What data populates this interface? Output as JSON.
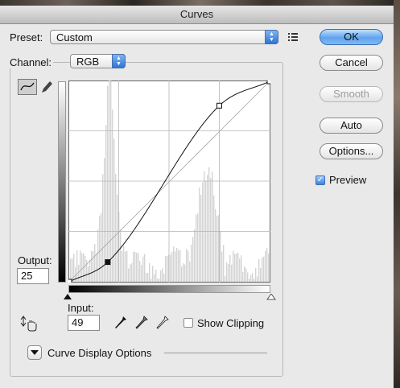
{
  "window": {
    "title": "Curves"
  },
  "preset": {
    "label": "Preset:",
    "value": "Custom"
  },
  "channel": {
    "label": "Channel:",
    "value": "RGB"
  },
  "buttons": {
    "ok": "OK",
    "cancel": "Cancel",
    "smooth": "Smooth",
    "auto": "Auto",
    "options": "Options..."
  },
  "preview": {
    "label": "Preview",
    "checked": true
  },
  "output": {
    "label": "Output:",
    "value": "25"
  },
  "input": {
    "label": "Input:",
    "value": "49"
  },
  "show_clipping": {
    "label": "Show Clipping",
    "checked": false
  },
  "curve_display_options": {
    "label": "Curve Display Options"
  },
  "curve": {
    "control_points": [
      [
        0,
        0
      ],
      [
        49,
        25
      ],
      [
        191,
        224
      ],
      [
        255,
        255
      ]
    ],
    "selected_point": [
      49,
      25
    ],
    "range": [
      0,
      255
    ]
  },
  "icons": [
    "curve-tool-icon",
    "pencil-icon",
    "hand-adjust-icon",
    "eyedropper-black-icon",
    "eyedropper-gray-icon",
    "eyedropper-white-icon",
    "disclosure-triangle-icon",
    "presets-menu-icon"
  ],
  "colors": {
    "ok_button": "#5fa3ee",
    "select_arrow": "#2f73d8",
    "histogram": "#d4d4d4"
  }
}
